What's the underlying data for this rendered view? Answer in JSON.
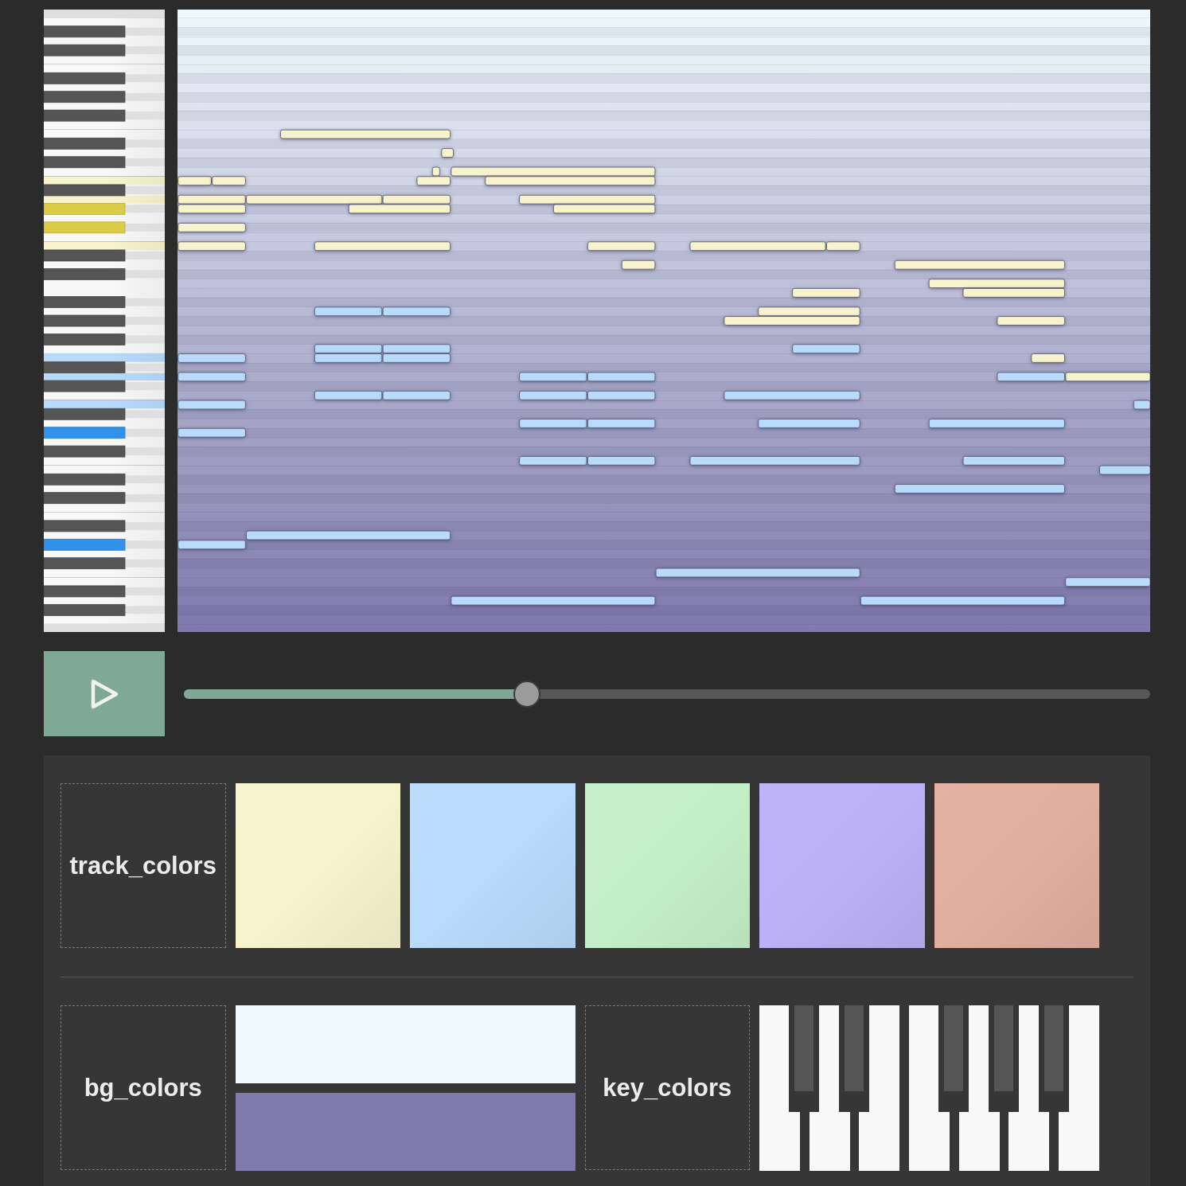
{
  "player": {
    "playing": false,
    "progress": {
      "level": 0.355
    }
  },
  "track_colors": {
    "label": "track_colors",
    "colors": [
      {
        "color": "#f7f3cc"
      },
      {
        "color": "#b8dafb"
      },
      {
        "color": "#c3efc6"
      },
      {
        "color": "#bcb0f7"
      },
      {
        "color": "#e2ae9f"
      }
    ]
  },
  "bg_colors": {
    "label": "bg_colors",
    "colors": [
      {
        "color": "#eff8fc"
      },
      {
        "color": "#7f79ac"
      }
    ]
  },
  "key_colors": {
    "label": "key_colors",
    "colors": [
      {
        "color": "#f8f8f8"
      },
      {
        "color": "#555555"
      }
    ]
  }
}
